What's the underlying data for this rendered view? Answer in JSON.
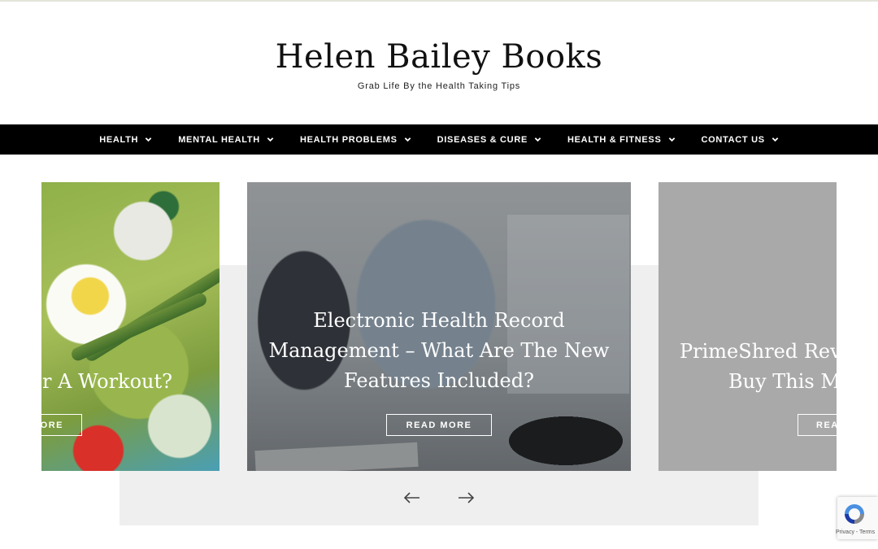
{
  "site": {
    "title": "Helen Bailey Books",
    "tagline": "Grab Life By the Health Taking Tips"
  },
  "nav": {
    "items": [
      {
        "label": "HEALTH",
        "icon": "chevron-down-icon"
      },
      {
        "label": "MENTAL HEALTH",
        "icon": "chevron-down-icon"
      },
      {
        "label": "HEALTH PROBLEMS",
        "icon": "chevron-down-icon"
      },
      {
        "label": "DISEASES & CURE",
        "icon": "chevron-down-icon"
      },
      {
        "label": "HEALTH & FITNESS",
        "icon": "chevron-down-icon"
      },
      {
        "label": "CONTACT US",
        "icon": "chevron-down-icon"
      }
    ]
  },
  "slider": {
    "slides": [
      {
        "title": "er A Workout?",
        "button": "ORE"
      },
      {
        "title": "Electronic Health Record Management – What Are The New Features Included?",
        "button": "READ MORE"
      },
      {
        "title_line1": "PrimeShred Revi",
        "title_line2": "Buy This Ma",
        "button": "REA"
      }
    ],
    "prev_icon": "arrow-left-icon",
    "next_icon": "arrow-right-icon"
  },
  "recaptcha": {
    "text": "Privacy - Terms",
    "icon": "recaptcha-icon"
  },
  "colors": {
    "nav_background": "#000000",
    "nav_text": "#ffffff",
    "slider_panel": "#efefef"
  }
}
